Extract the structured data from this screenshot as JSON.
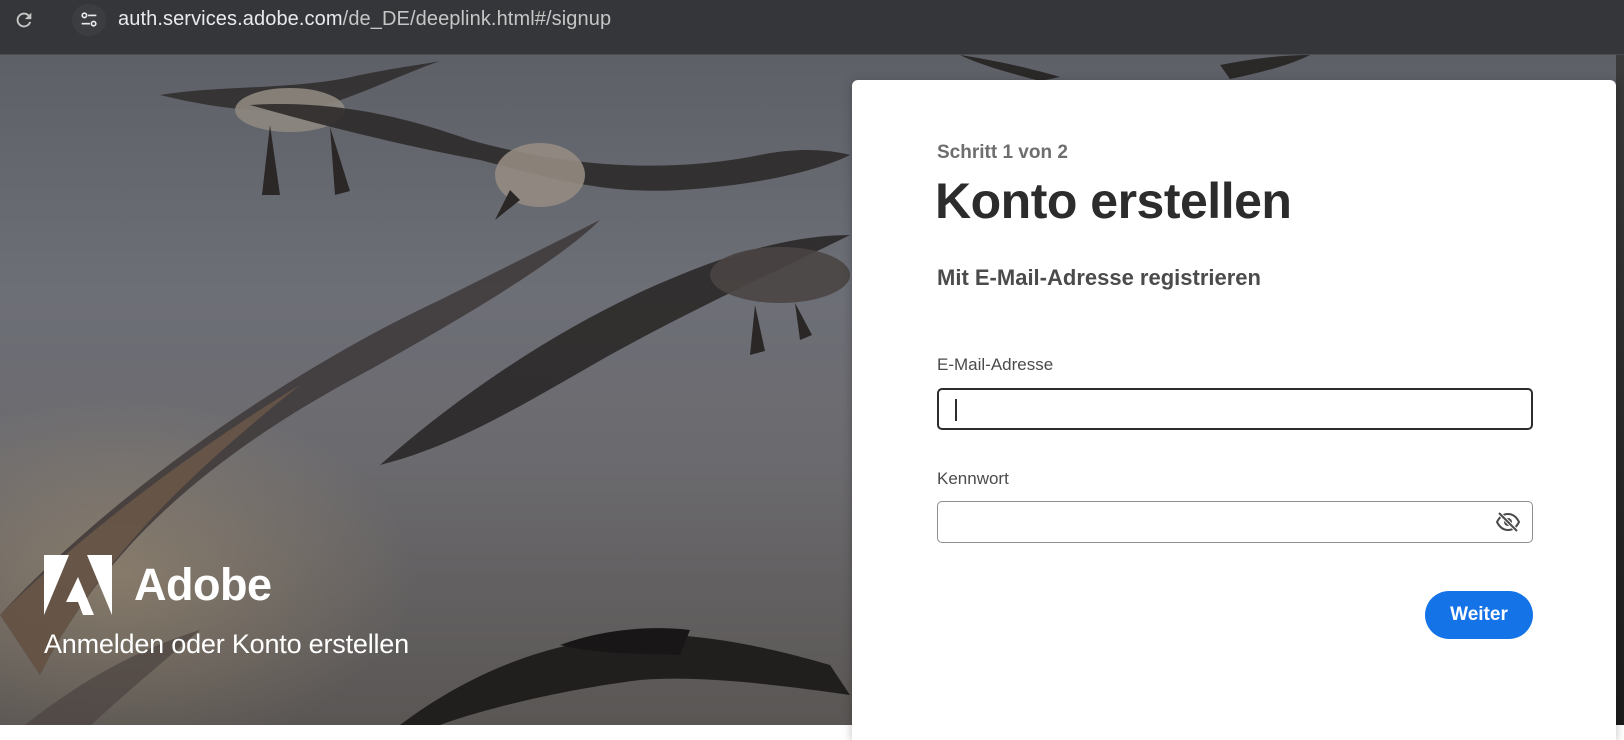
{
  "browser": {
    "url_host": "auth.services.adobe.com",
    "url_path": "/de_DE/deeplink.html#/signup",
    "reload_icon": "reload-icon",
    "site_info_icon": "tune-icon"
  },
  "brand": {
    "name": "Adobe",
    "tagline": "Anmelden oder Konto erstellen",
    "logo_icon": "adobe-logo"
  },
  "form": {
    "step": "Schritt 1 von 2",
    "title": "Konto erstellen",
    "subtitle": "Mit E-Mail-Adresse registrieren",
    "email_label": "E-Mail-Adresse",
    "email_value": "",
    "password_label": "Kennwort",
    "password_value": "",
    "toggle_password_icon": "eye-off-icon",
    "next_button": "Weiter"
  },
  "colors": {
    "accent": "#1473e6",
    "card_background": "#ffffff",
    "browser_bar": "#35363a"
  }
}
